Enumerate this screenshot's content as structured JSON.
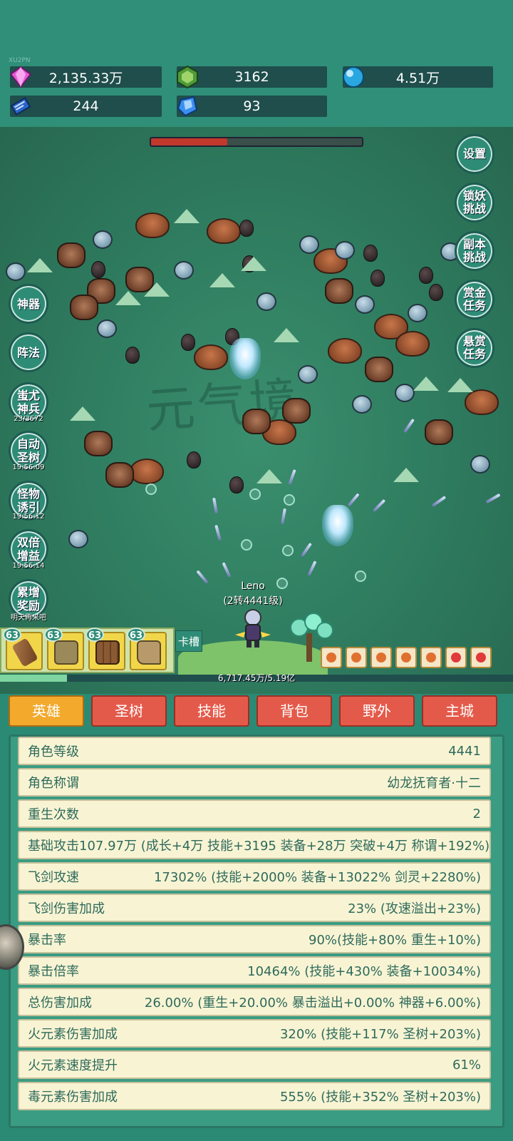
{
  "uid": "XU2PN",
  "resources": {
    "gem": "2,135.33万",
    "green_crystal": "3162",
    "orb": "4.51万",
    "book": "244",
    "blue_shard": "93"
  },
  "boss_hp": 0.36,
  "watermark": "元气境",
  "right_buttons": {
    "settings": "设置",
    "lock_demon": "锁妖\n挑战",
    "dungeon": "副本\n挑战",
    "bounty_task": "赏金\n任务",
    "reward_task": "悬赏\n任务"
  },
  "left_buttons": {
    "artifact": "神器",
    "formation": "阵法",
    "chiyou": "蚩尤\n神兵",
    "chiyou_timer": "23/3672",
    "auto_tree": "自动\n圣树",
    "auto_tree_timer": "19:56:09",
    "lure": "怪物\n诱引",
    "lure_timer": "19:56:12",
    "double": "双倍\n增益",
    "double_timer": "19:56:14",
    "accum": "累增\n奖励",
    "accum_note": "明天再来吧"
  },
  "hero": {
    "name": "Leno",
    "level": "(2转4441级)"
  },
  "equipment_levels": [
    "63",
    "63",
    "63",
    "63"
  ],
  "card_slot": "卡槽",
  "exp": {
    "text": "6,717.45万/5.19亿",
    "fraction": 0.13
  },
  "tabs": [
    "英雄",
    "圣树",
    "技能",
    "背包",
    "野外",
    "主城"
  ],
  "stats": [
    {
      "label": "角色等级",
      "value": "4441"
    },
    {
      "label": "角色称谓",
      "value": "幼龙抚育者·十二"
    },
    {
      "label": "重生次数",
      "value": "2"
    },
    {
      "label": "基础攻击",
      "value": "107.97万 (成长+4万 技能+3195 装备+28万 突破+4万 称谓+192%)"
    },
    {
      "label": "飞剑攻速",
      "value": "17302% (技能+2000% 装备+13022% 剑灵+2280%)"
    },
    {
      "label": "飞剑伤害加成",
      "value": "23% (攻速溢出+23%)"
    },
    {
      "label": "暴击率",
      "value": "90%(技能+80% 重生+10%)"
    },
    {
      "label": "暴击倍率",
      "value": "10464% (技能+430% 装备+10034%)"
    },
    {
      "label": "总伤害加成",
      "value": "26.00% (重生+20.00% 暴击溢出+0.00% 神器+6.00%)"
    },
    {
      "label": "火元素伤害加成",
      "value": "320% (技能+117% 圣树+203%)"
    },
    {
      "label": "火元素速度提升",
      "value": "61%"
    },
    {
      "label": "毒元素伤害加成",
      "value": "555% (技能+352% 圣树+203%)"
    }
  ],
  "colors": {
    "accent": "#2e8c76",
    "tab_active": "#f2a92c",
    "tab_inactive": "#e45a4a",
    "row_bg": "#f8f4d3",
    "boss_hp": "#c0392b"
  }
}
